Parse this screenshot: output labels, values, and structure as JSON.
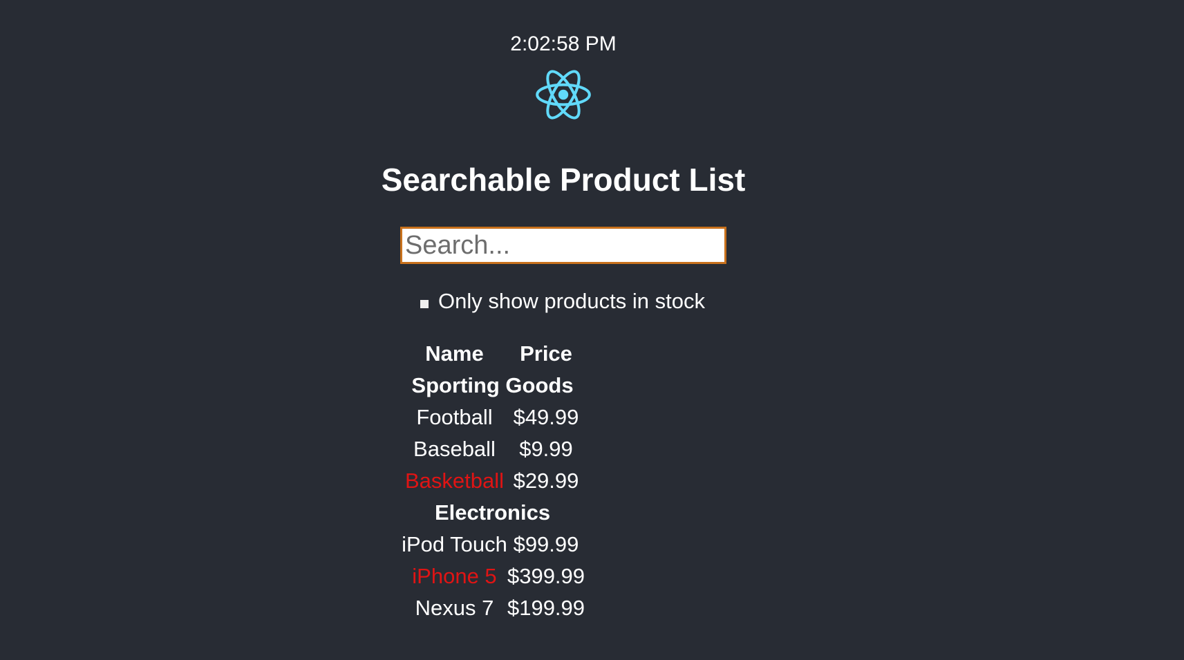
{
  "clock": "2:02:58 PM",
  "logo_icon": "react-atom-icon",
  "title": "Searchable Product List",
  "search": {
    "placeholder": "Search...",
    "value": ""
  },
  "stock_filter": {
    "label": "Only show products in stock",
    "checked": false
  },
  "table": {
    "headers": {
      "name": "Name",
      "price": "Price"
    },
    "categories": [
      {
        "name": "Sporting Goods",
        "rows": [
          {
            "name": "Football",
            "price": "$49.99",
            "in_stock": true
          },
          {
            "name": "Baseball",
            "price": "$9.99",
            "in_stock": true
          },
          {
            "name": "Basketball",
            "price": "$29.99",
            "in_stock": false
          }
        ]
      },
      {
        "name": "Electronics",
        "rows": [
          {
            "name": "iPod Touch",
            "price": "$99.99",
            "in_stock": true
          },
          {
            "name": "iPhone 5",
            "price": "$399.99",
            "in_stock": false
          },
          {
            "name": "Nexus 7",
            "price": "$199.99",
            "in_stock": true
          }
        ]
      }
    ]
  },
  "colors": {
    "background": "#282c34",
    "text": "#ffffff",
    "out_of_stock": "#e01414",
    "search_border": "#c8711c",
    "react_logo": "#61dafb"
  }
}
